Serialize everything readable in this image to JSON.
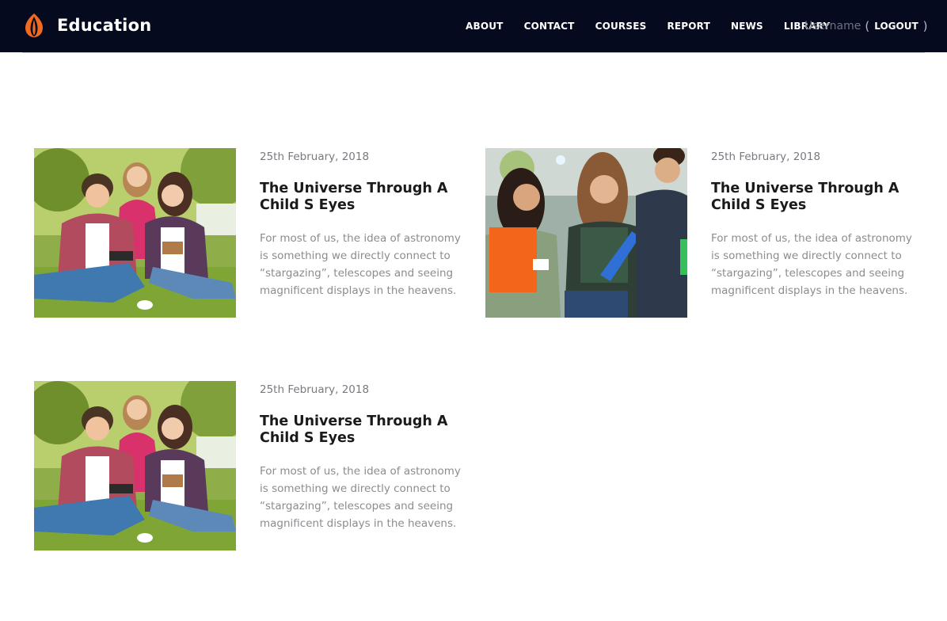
{
  "brand": {
    "name": "Education",
    "logo_icon": "flame-logo-icon",
    "accent": "#f26a22"
  },
  "nav": {
    "links": [
      "ABOUT",
      "CONTACT",
      "COURSES",
      "REPORT",
      "NEWS",
      "LIBRARY"
    ],
    "username": "Username",
    "paren_open": "(",
    "logout": "LOGOUT",
    "paren_close": ")"
  },
  "posts": [
    {
      "image": "students-reading-on-grass",
      "date": "25th February, 2018",
      "title": "The Universe Through A Child S Eyes",
      "excerpt": "For most of us, the idea of astronomy is something we directly connect to “stargazing”, telescopes and seeing magnificent displays in the heavens."
    },
    {
      "image": "students-walking-with-folders",
      "date": "25th February, 2018",
      "title": "The Universe Through A Child S Eyes",
      "excerpt": "For most of us, the idea of astronomy is something we directly connect to “stargazing”, telescopes and seeing magnificent displays in the heavens."
    },
    {
      "image": "students-reading-on-grass",
      "date": "25th February, 2018",
      "title": "The Universe Through A Child S Eyes",
      "excerpt": "For most of us, the idea of astronomy is something we directly connect to “stargazing”, telescopes and seeing magnificent displays in the heavens."
    }
  ],
  "colors": {
    "navbar": "#050a1f",
    "title": "#1a1a1a",
    "muted": "#8a8c90"
  }
}
